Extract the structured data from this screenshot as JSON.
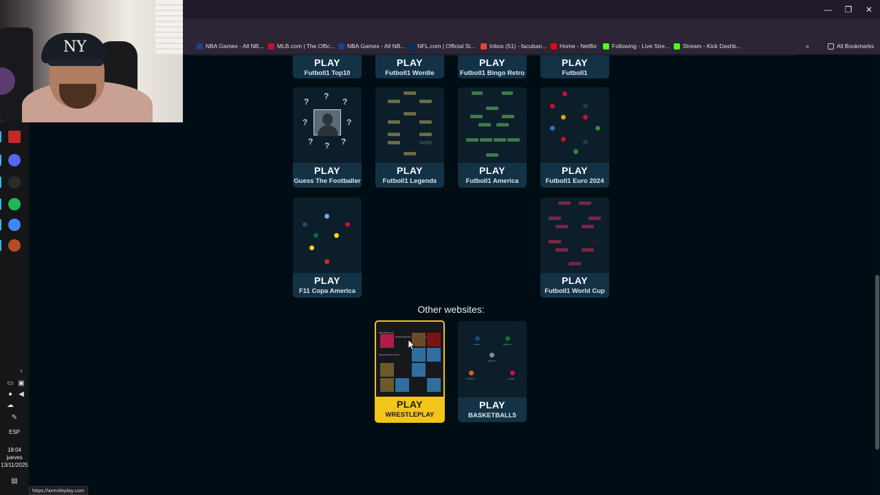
{
  "browser": {
    "window_controls": {
      "minimize": "—",
      "restore": "❐",
      "close": "✕"
    },
    "bookmarks": [
      {
        "label": "NBA Games - All NB...",
        "color": "#1d428a"
      },
      {
        "label": "MLB.com | The Offic...",
        "color": "#c8102e"
      },
      {
        "label": "NBA Games - All NB...",
        "color": "#1d428a"
      },
      {
        "label": "NFL.com | Official Si...",
        "color": "#013369"
      },
      {
        "label": "Inbox (51) - facuban...",
        "color": "#ea4335"
      },
      {
        "label": "Home - Netflix",
        "color": "#e50914"
      },
      {
        "label": "Following - Live Stre...",
        "color": "#53fc18"
      },
      {
        "label": "Stream - Kick Dashb...",
        "color": "#53fc18"
      }
    ],
    "overflow_label": "»",
    "all_bookmarks_label": "All Bookmarks",
    "status_url": "https://wrestleplay.com"
  },
  "webcam": {
    "cap_logo": "NY"
  },
  "taskbar": {
    "apps": [
      {
        "name": "app-viewer-icon",
        "color": "#c62828"
      },
      {
        "name": "discord-icon",
        "color": "#5865f2"
      },
      {
        "name": "obs-icon",
        "color": "#2b2b2b"
      },
      {
        "name": "spotify-icon",
        "color": "#1db954"
      },
      {
        "name": "chrome-icon",
        "color": "#4285f4"
      },
      {
        "name": "game-icon",
        "color": "#b54a2a"
      }
    ],
    "language": "ESP",
    "time": "18:04",
    "day": "jueves",
    "date": "13/11/2025"
  },
  "games": {
    "play_label": "PLAY",
    "top_row": [
      "Futboll1 Top10",
      "Futboll1 Wordle",
      "Futboll1 Bingo Retro",
      "Futboll1"
    ],
    "middle_row": [
      "Guess The Footballer",
      "Futboll1 Legends",
      "Futboll1 America",
      "Futboll1 Euro 2024"
    ],
    "bottom_row": [
      "F11 Copa America",
      "Futboll1 World Cup"
    ]
  },
  "other_websites": {
    "heading": "Other websites:",
    "sites": [
      {
        "play": "PLAY",
        "name": "WRESTLEPLAY"
      },
      {
        "play": "PLAY",
        "name": "BASKETBALL5"
      }
    ],
    "wrestle_thumb_text": [
      "WrestlePlay 2x4",
      "Tamed Champion 2x4 Pro Wr Title",
      "Tamed Winners of Pro..."
    ],
    "basket_players": [
      "CURRY",
      "BROWN",
      "DUNAC",
      "DURANT",
      "LFORE"
    ]
  }
}
